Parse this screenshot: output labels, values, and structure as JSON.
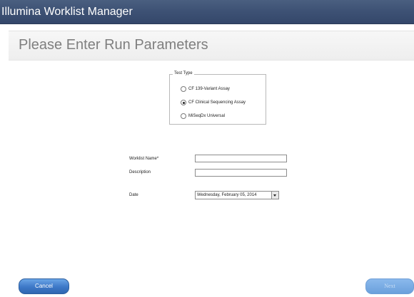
{
  "window": {
    "title": "Illumina Worklist Manager"
  },
  "page": {
    "heading": "Please Enter Run Parameters"
  },
  "test_type": {
    "legend": "Test Type",
    "options": [
      {
        "label": "CF 139-Variant Assay",
        "selected": false
      },
      {
        "label": "CF Clinical Sequencing Assay",
        "selected": true
      },
      {
        "label": "MiSeqDx Universal",
        "selected": false
      }
    ]
  },
  "form": {
    "worklist_name": {
      "label": "Worklist Name*",
      "value": ""
    },
    "description": {
      "label": "Description",
      "value": ""
    },
    "date": {
      "label": "Date",
      "value": "Wednesday,  February  05, 2014"
    }
  },
  "buttons": {
    "cancel": "Cancel",
    "next": "Next"
  },
  "colors": {
    "titlebar": "#3e5275",
    "button_blue": "#3d78c7",
    "heading_gray": "#7f7f7f"
  }
}
